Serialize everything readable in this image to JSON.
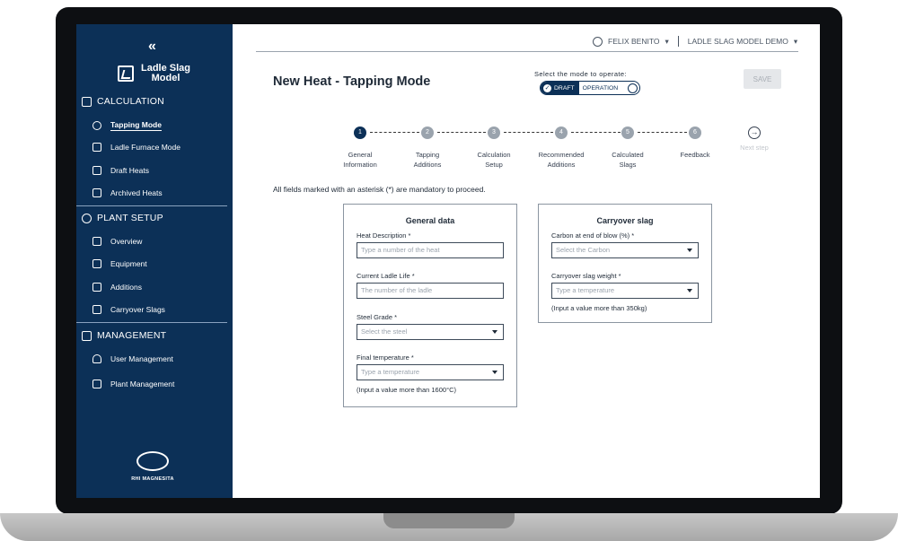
{
  "sidebar": {
    "collapse_icon": "«",
    "logo_line1": "Ladle Slag",
    "logo_line2": "Model",
    "sections": {
      "calculation": "CALCULATION",
      "plant_setup": "PLANT SETUP",
      "management": "MANAGEMENT"
    },
    "items": {
      "tapping": "Tapping Mode",
      "ladle_furnace": "Ladle Furnace Mode",
      "draft_heats": "Draft Heats",
      "archived_heats": "Archived Heats",
      "overview": "Overview",
      "equipment": "Equipment",
      "additions": "Additions",
      "carryover": "Carryover Slags",
      "user_mgmt": "User Management",
      "plant_mgmt": "Plant Management"
    },
    "brand": "RHI MAGNESITA"
  },
  "header": {
    "user": "FELIX BENITO",
    "model": "LADLE SLAG MODEL DEMO",
    "title": "New Heat - Tapping Mode",
    "mode_label": "Select the mode to operate:",
    "mode_draft": "DRAFT",
    "mode_operation": "OPERATION",
    "save": "SAVE"
  },
  "stepper": {
    "steps": [
      {
        "num": "1",
        "line1": "General",
        "line2": "Information"
      },
      {
        "num": "2",
        "line1": "Tapping",
        "line2": "Additions"
      },
      {
        "num": "3",
        "line1": "Calculation",
        "line2": "Setup"
      },
      {
        "num": "4",
        "line1": "Recommended",
        "line2": "Additions"
      },
      {
        "num": "5",
        "line1": "Calculated",
        "line2": "Slags"
      },
      {
        "num": "6",
        "line1": "Feedback",
        "line2": ""
      }
    ],
    "next": "Next step"
  },
  "note": "All fields marked with an asterisk (*) are mandatory to proceed.",
  "general": {
    "title": "General data",
    "heat_label": "Heat Description *",
    "heat_ph": "Type a number of the heat",
    "ladle_label": "Current Ladle Life *",
    "ladle_ph": "The number of the ladle",
    "steel_label": "Steel Grade *",
    "steel_ph": "Select the steel",
    "temp_label": "Final temperature *",
    "temp_ph": "Type a temperature",
    "temp_hint": "(Input a value more than 1600°C)"
  },
  "carryover": {
    "title": "Carryover slag",
    "carbon_label": "Carbon at end of blow (%) *",
    "carbon_ph": "Select the Carbon",
    "weight_label": "Carryover slag weight *",
    "weight_ph": "Type a temperature",
    "weight_hint": "(Input a value more than 350kg)"
  }
}
